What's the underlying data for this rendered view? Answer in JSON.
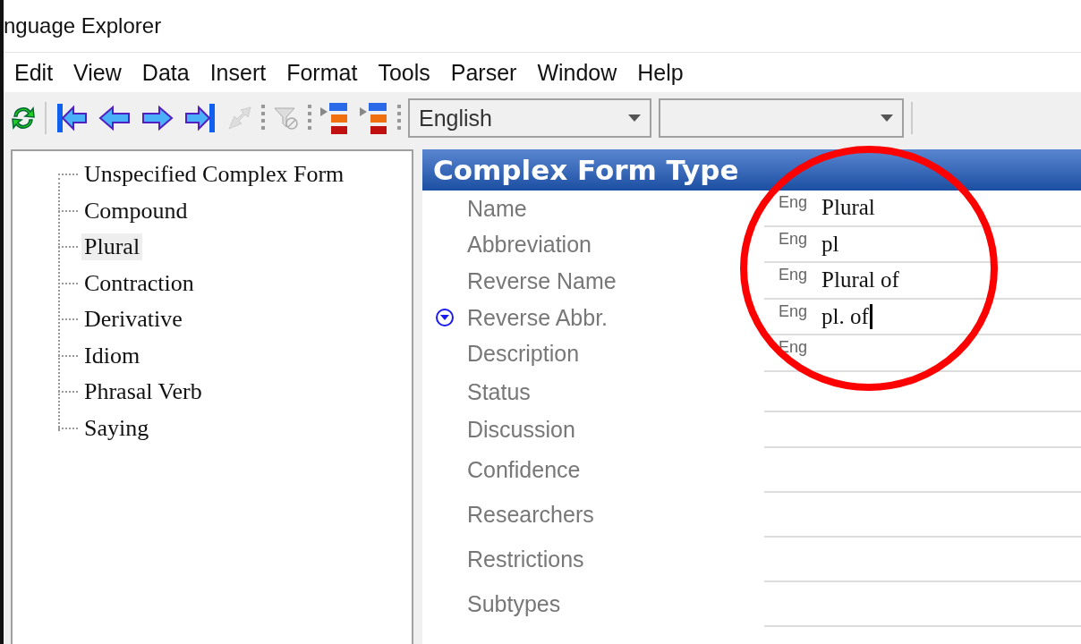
{
  "window": {
    "title": "nguage Explorer"
  },
  "menu": [
    "Edit",
    "View",
    "Data",
    "Insert",
    "Format",
    "Tools",
    "Parser",
    "Window",
    "Help"
  ],
  "toolbar": {
    "writing_system": "English"
  },
  "tree": [
    {
      "label": "Unspecified Complex Form",
      "selected": false
    },
    {
      "label": "Compound",
      "selected": false
    },
    {
      "label": "Plural",
      "selected": true
    },
    {
      "label": "Contraction",
      "selected": false
    },
    {
      "label": "Derivative",
      "selected": false
    },
    {
      "label": "Idiom",
      "selected": false
    },
    {
      "label": "Phrasal Verb",
      "selected": false
    },
    {
      "label": "Saying",
      "selected": false
    }
  ],
  "detail": {
    "title": "Complex Form Type",
    "fields": [
      {
        "kind": "multi",
        "label": "Name",
        "ws": "Eng",
        "value": "Plural",
        "focused": false
      },
      {
        "kind": "multi",
        "label": "Abbreviation",
        "ws": "Eng",
        "value": "pl",
        "focused": false
      },
      {
        "kind": "multi",
        "label": "Reverse Name",
        "ws": "Eng",
        "value": "Plural of",
        "focused": false
      },
      {
        "kind": "multi",
        "label": "Reverse Abbr.",
        "ws": "Eng",
        "value": "pl. of",
        "focused": true
      },
      {
        "kind": "multi",
        "label": "Description",
        "ws": "Eng",
        "focused": false
      },
      {
        "kind": "plain",
        "label": "Status"
      },
      {
        "kind": "plain",
        "label": "Discussion"
      },
      {
        "kind": "plain",
        "label": "Confidence"
      },
      {
        "kind": "plain",
        "label": "Researchers"
      },
      {
        "kind": "plain",
        "label": "Restrictions"
      },
      {
        "kind": "plain",
        "label": "Subtypes"
      }
    ]
  },
  "highlight_circle": true
}
